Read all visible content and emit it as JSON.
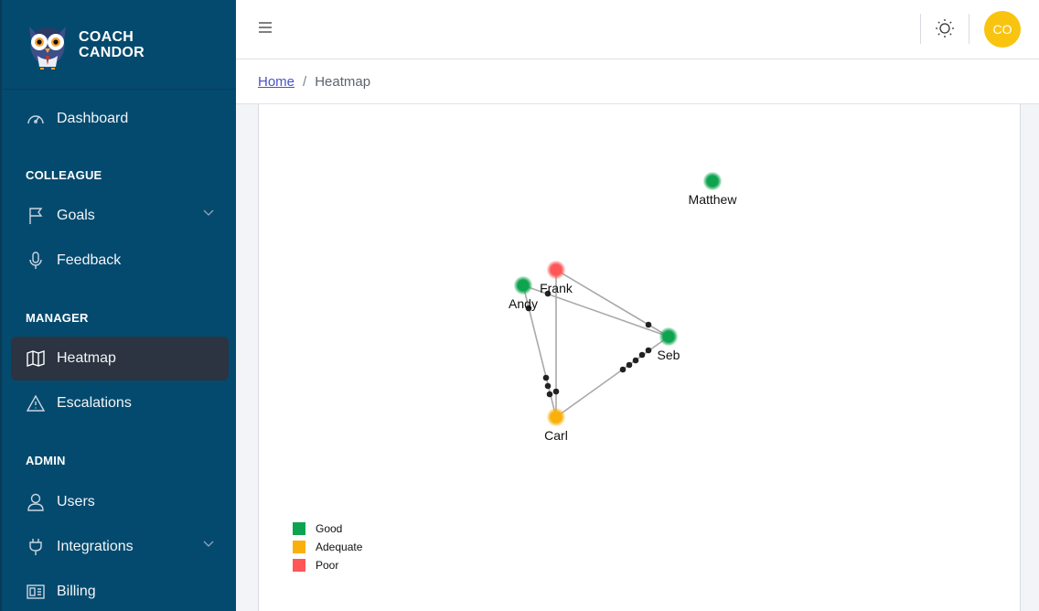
{
  "brand": {
    "line1": "COACH",
    "line2": "CANDOR"
  },
  "sidebar": {
    "dashboard": "Dashboard",
    "section_colleague": "COLLEAGUE",
    "goals": "Goals",
    "feedback": "Feedback",
    "section_manager": "MANAGER",
    "heatmap": "Heatmap",
    "escalations": "Escalations",
    "section_admin": "ADMIN",
    "users": "Users",
    "integrations": "Integrations",
    "billing": "Billing"
  },
  "header": {
    "avatar_initials": "CO"
  },
  "breadcrumb": {
    "home": "Home",
    "current": "Heatmap"
  },
  "colors": {
    "good": "#0ea44f",
    "adequate": "#f9b00b",
    "poor": "#ff5757",
    "sidebar": "#044a6e",
    "accent": "#f9c40f"
  },
  "heatmap": {
    "nodes": [
      {
        "id": "matthew",
        "label": "Matthew",
        "status": "good"
      },
      {
        "id": "frank",
        "label": "Frank",
        "status": "poor"
      },
      {
        "id": "andy",
        "label": "Andy",
        "status": "good"
      },
      {
        "id": "seb",
        "label": "Seb",
        "status": "good"
      },
      {
        "id": "carl",
        "label": "Carl",
        "status": "adequate"
      }
    ],
    "edges": [
      {
        "from": "frank",
        "to": "seb"
      },
      {
        "from": "andy",
        "to": "seb"
      },
      {
        "from": "andy",
        "to": "carl"
      },
      {
        "from": "frank",
        "to": "carl"
      },
      {
        "from": "carl",
        "to": "seb"
      }
    ],
    "legend": [
      {
        "label": "Good",
        "status": "good"
      },
      {
        "label": "Adequate",
        "status": "adequate"
      },
      {
        "label": "Poor",
        "status": "poor"
      }
    ]
  }
}
